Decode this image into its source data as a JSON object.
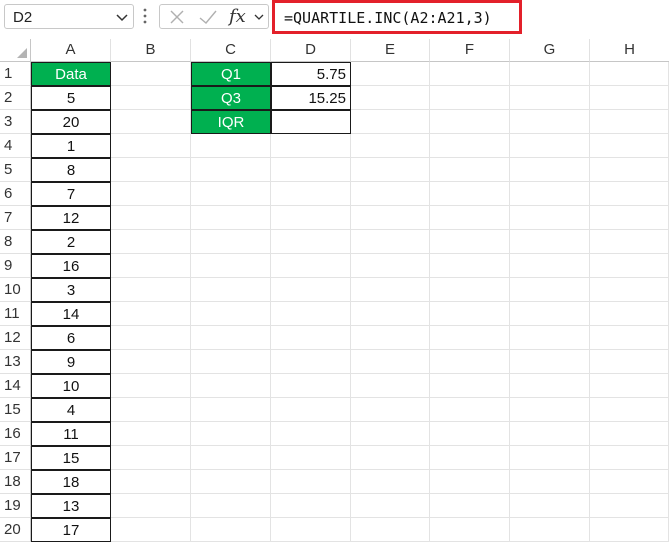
{
  "name_box": {
    "value": "D2"
  },
  "formula_bar": {
    "fx_label": "fx",
    "formula": "=QUARTILE.INC(A2:A21,3)"
  },
  "columns": [
    "A",
    "B",
    "C",
    "D",
    "E",
    "F",
    "G",
    "H"
  ],
  "rows": [
    "1",
    "2",
    "3",
    "4",
    "5",
    "6",
    "7",
    "8",
    "9",
    "10",
    "11",
    "12",
    "13",
    "14",
    "15",
    "16",
    "17",
    "18",
    "19",
    "20"
  ],
  "column_a": [
    "Data",
    "5",
    "20",
    "1",
    "8",
    "7",
    "12",
    "2",
    "16",
    "3",
    "14",
    "6",
    "9",
    "10",
    "4",
    "11",
    "15",
    "18",
    "13",
    "17"
  ],
  "summary_table": [
    {
      "label": "Q1",
      "value": "5.75"
    },
    {
      "label": "Q3",
      "value": "15.25"
    },
    {
      "label": "IQR",
      "value": ""
    }
  ],
  "colors": {
    "header_green": "#00b050",
    "highlight_red": "#e3202a"
  }
}
